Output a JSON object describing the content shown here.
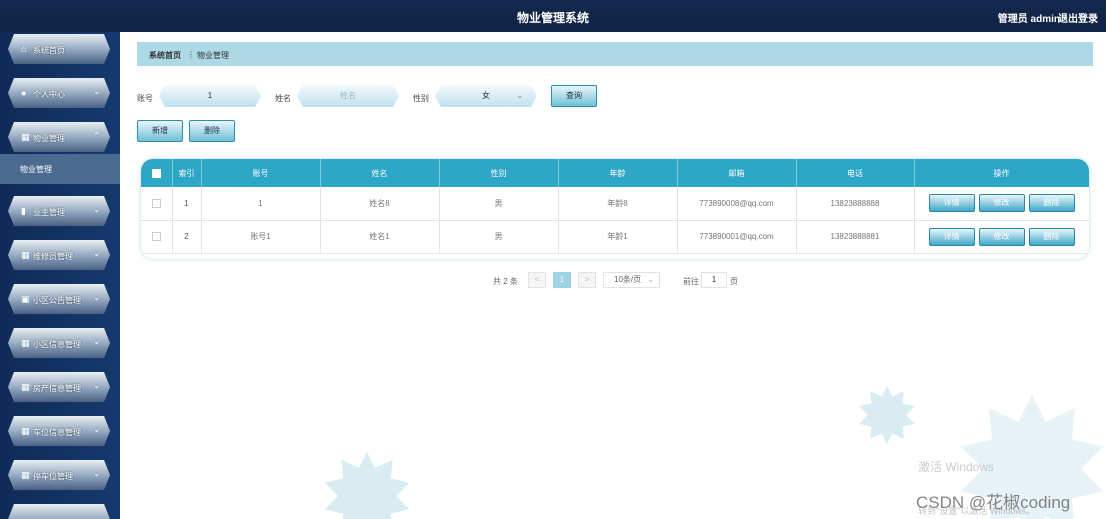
{
  "header": {
    "title": "物业管理系统",
    "user": "管理员 admin",
    "logout": "退出登录"
  },
  "sidebar": {
    "items": [
      {
        "label": "系统首页",
        "icon": "home-icon",
        "glyph": "⌂"
      },
      {
        "label": "个人中心",
        "icon": "person-icon",
        "glyph": "●"
      },
      {
        "label": "物业管理",
        "icon": "grid-icon",
        "glyph": "▦"
      },
      {
        "label": "业主管理",
        "icon": "bar-chart-icon",
        "glyph": "▮"
      },
      {
        "label": "维修员管理",
        "icon": "grid-icon",
        "glyph": "▦"
      },
      {
        "label": "小区公告管理",
        "icon": "clipboard-icon",
        "glyph": "▣"
      },
      {
        "label": "小区信息管理",
        "icon": "grid-icon",
        "glyph": "▦"
      },
      {
        "label": "房产信息管理",
        "icon": "grid-icon",
        "glyph": "▦"
      },
      {
        "label": "车位信息管理",
        "icon": "grid-icon",
        "glyph": "▦"
      },
      {
        "label": "停车位管理",
        "icon": "grid-icon",
        "glyph": "▦"
      }
    ],
    "submenu": "物业管理"
  },
  "breadcrumb": {
    "home": "系统首页",
    "separator": "⋮",
    "current": "物业管理"
  },
  "search": {
    "account_label": "账号",
    "account_value": "1",
    "name_label": "姓名",
    "name_placeholder": "姓名",
    "gender_label": "性别",
    "gender_value": "女",
    "query_button": "查询"
  },
  "actions": {
    "add": "新增",
    "delete": "删除"
  },
  "table": {
    "headers": [
      "索引",
      "账号",
      "姓名",
      "性别",
      "年龄",
      "邮箱",
      "电话",
      "操作"
    ],
    "rows": [
      {
        "index": "1",
        "account": "1",
        "name": "姓名8",
        "gender": "男",
        "age": "年龄8",
        "email": "773890008@qq.com",
        "phone": "13823888888"
      },
      {
        "index": "2",
        "account": "账号1",
        "name": "姓名1",
        "gender": "男",
        "age": "年龄1",
        "email": "773890001@qq.com",
        "phone": "13823888881"
      }
    ],
    "row_actions": {
      "detail": "详情",
      "edit": "修改",
      "delete": "删除"
    }
  },
  "pagination": {
    "total": "共 2 条",
    "prev": "<",
    "page": "1",
    "next": ">",
    "page_size": "10条/页",
    "goto_label": "前往",
    "goto_value": "1",
    "goto_suffix": "页"
  },
  "watermark": {
    "csdn": "CSDN @花椒coding",
    "activate": "激活 Windows",
    "activate_sub": "转到\"设置\"以激活 Windows。"
  },
  "colors": {
    "header_bg": "#0e2244",
    "table_header": "#2ea6c6",
    "breadcrumb_bg": "#add8e6"
  }
}
